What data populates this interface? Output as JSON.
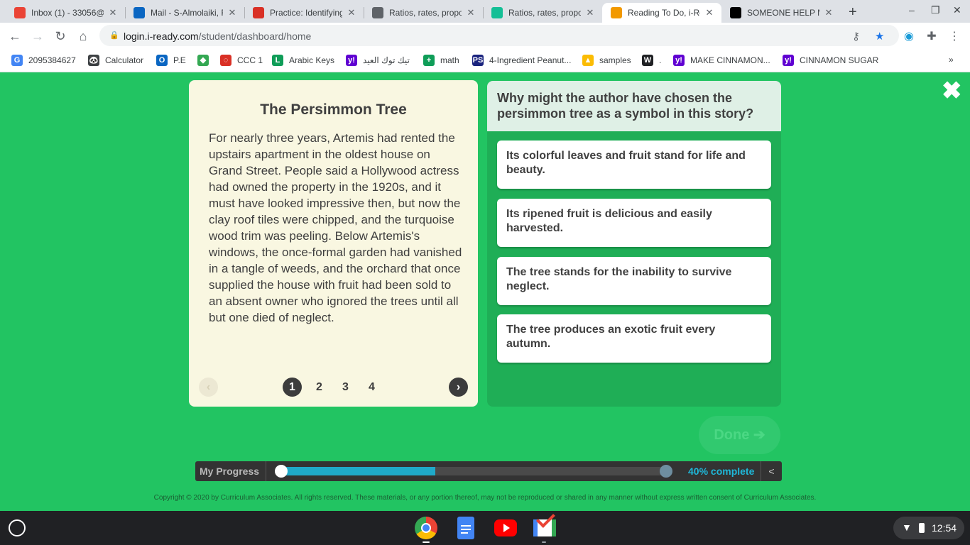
{
  "browser": {
    "tabs": [
      {
        "title": "Inbox (1) - 33056@",
        "icon": "gmail-icon",
        "color": "#ea4335"
      },
      {
        "title": "Mail - S-Almolaiki, F",
        "icon": "outlook-icon",
        "color": "#0a66c2"
      },
      {
        "title": "Practice: Identifying",
        "icon": "khan-icon",
        "color": "#d93025"
      },
      {
        "title": "Ratios, rates, propo",
        "icon": "globe-icon",
        "color": "#5f6368"
      },
      {
        "title": "Ratios, rates, propo",
        "icon": "khan-icon",
        "color": "#14bf96"
      },
      {
        "title": "Reading To Do, i-Re",
        "icon": "iready-icon",
        "color": "#f29900",
        "active": true
      },
      {
        "title": "SOMEONE HELP M",
        "icon": "brainly-icon",
        "color": "#000000"
      }
    ],
    "new_tab": "+",
    "window_controls": {
      "minimize": "–",
      "restore": "❐",
      "close": "✕"
    },
    "url": {
      "host": "login.i-ready.com",
      "path": "/student/dashboard/home"
    },
    "bookmarks": [
      {
        "label": "2095384627",
        "icon": "google-icon",
        "color": "#4285f4",
        "glyph": "G"
      },
      {
        "label": "Calculator",
        "icon": "calculator-icon",
        "color": "#3c4043",
        "glyph": "🐼"
      },
      {
        "label": "P.E",
        "icon": "outlook-icon",
        "color": "#0a66c2",
        "glyph": "O"
      },
      {
        "label": "",
        "icon": "cube-icon",
        "color": "#34a853",
        "glyph": "◆"
      },
      {
        "label": "CCC 1",
        "icon": "khan-icon",
        "color": "#d93025",
        "glyph": "◌"
      },
      {
        "label": "Arabic Keys",
        "icon": "l-icon",
        "color": "#0f9d58",
        "glyph": "L"
      },
      {
        "label": "تيك توك العيد",
        "icon": "yahoo-icon",
        "color": "#6001d2",
        "glyph": "y!"
      },
      {
        "label": "math",
        "icon": "sheet-icon",
        "color": "#0f9d58",
        "glyph": "+"
      },
      {
        "label": "4-Ingredient Peanut...",
        "icon": "ps-icon",
        "color": "#1a237e",
        "glyph": "PS"
      },
      {
        "label": "samples",
        "icon": "drive-icon",
        "color": "#fbbc04",
        "glyph": "▲"
      },
      {
        "label": ".",
        "icon": "w-icon",
        "color": "#202124",
        "glyph": "W"
      },
      {
        "label": "MAKE CINNAMON...",
        "icon": "yahoo-icon",
        "color": "#6001d2",
        "glyph": "y!"
      },
      {
        "label": "CINNAMON SUGAR",
        "icon": "yahoo-icon",
        "color": "#6001d2",
        "glyph": "y!"
      }
    ],
    "bookmarks_more": "»"
  },
  "passage": {
    "title": "The Persimmon Tree",
    "text": "For nearly three years, Artemis had rented the upstairs apartment in the oldest house on Grand Street. People said a Hollywood actress had owned the property in the 1920s, and it must have looked impressive then, but now the clay roof tiles were chipped, and the turquoise wood trim was peeling. Below Artemis's windows, the once-formal garden had vanished in a tangle of weeds, and the orchard that once supplied the house with fruit had been sold to an absent owner who ignored the trees until all but one died of neglect.",
    "pages": [
      "1",
      "2",
      "3",
      "4"
    ],
    "current_page": "1",
    "prev": "‹",
    "next": "›"
  },
  "question": {
    "prompt": "Why might the author have chosen the persimmon tree as a symbol in this story?",
    "answers": [
      "Its colorful leaves and fruit stand for life and beauty.",
      "Its ripened fruit is delicious and easily harvested.",
      "The tree stands for the inability to survive neglect.",
      "The tree produces an exotic fruit every autumn."
    ]
  },
  "done_button": "Done",
  "progress": {
    "label": "My Progress",
    "percent_text": "40% complete",
    "fraction": 0.4,
    "toggle": "<"
  },
  "close_symbol": "✖",
  "copyright": "Copyright © 2020 by Curriculum Associates. All rights reserved. These materials, or any portion thereof, may not be reproduced or shared in any manner without express written consent of Curriculum Associates.",
  "taskbar": {
    "apps": [
      "chrome-icon",
      "docs-icon",
      "youtube-icon",
      "gmail-icon"
    ],
    "time": "12:54"
  }
}
